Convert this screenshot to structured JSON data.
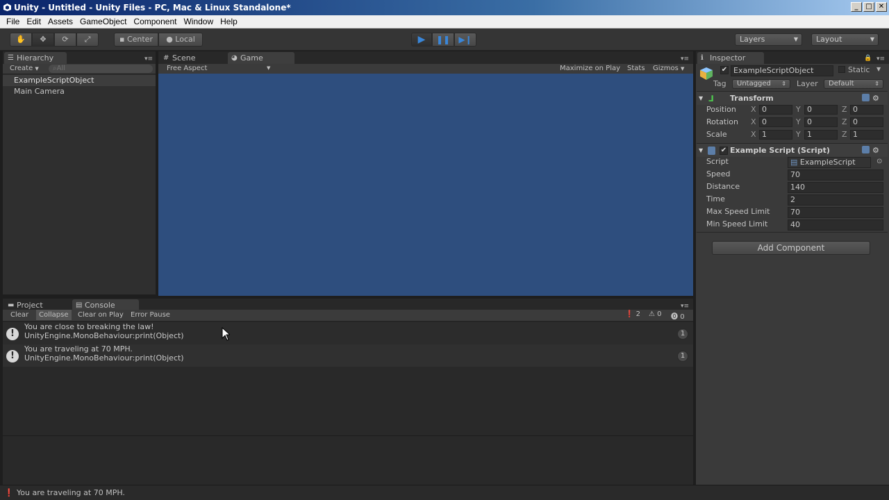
{
  "window": {
    "title": "Unity - Untitled - Unity Files - PC, Mac & Linux Standalone*",
    "minimize": "_",
    "maximize": "□",
    "close": "✕"
  },
  "menu": [
    "File",
    "Edit",
    "Assets",
    "GameObject",
    "Component",
    "Window",
    "Help"
  ],
  "toolbar": {
    "pivot_label": "Center",
    "space_label": "Local",
    "layers_label": "Layers",
    "layout_label": "Layout"
  },
  "hierarchy": {
    "tab_label": "Hierarchy",
    "create_label": "Create",
    "search_placeholder": "All",
    "items": [
      "ExampleScriptObject",
      "Main Camera"
    ]
  },
  "scene": {
    "scene_tab": "Scene",
    "game_tab": "Game",
    "aspect": "Free Aspect",
    "maximize": "Maximize on Play",
    "stats": "Stats",
    "gizmos": "Gizmos"
  },
  "inspector": {
    "tab_label": "Inspector",
    "object_name": "ExampleScriptObject",
    "static_label": "Static",
    "tag_label": "Tag",
    "tag_value": "Untagged",
    "layer_label": "Layer",
    "layer_value": "Default",
    "transform": {
      "title": "Transform",
      "rows": [
        {
          "label": "Position",
          "x": "0",
          "y": "0",
          "z": "0"
        },
        {
          "label": "Rotation",
          "x": "0",
          "y": "0",
          "z": "0"
        },
        {
          "label": "Scale",
          "x": "1",
          "y": "1",
          "z": "1"
        }
      ],
      "axis_x": "X",
      "axis_y": "Y",
      "axis_z": "Z"
    },
    "script": {
      "title": "Example Script (Script)",
      "script_label": "Script",
      "script_value": "ExampleScript",
      "fields": [
        {
          "label": "Speed",
          "value": "70"
        },
        {
          "label": "Distance",
          "value": "140"
        },
        {
          "label": "Time",
          "value": "2"
        },
        {
          "label": "Max Speed Limit",
          "value": "70"
        },
        {
          "label": "Min Speed Limit",
          "value": "40"
        }
      ]
    },
    "add_component": "Add Component"
  },
  "console": {
    "project_tab": "Project",
    "console_tab": "Console",
    "buttons": [
      "Clear",
      "Collapse",
      "Clear on Play",
      "Error Pause"
    ],
    "counts": {
      "log": "2",
      "warn": "0",
      "error": "0"
    },
    "entries": [
      {
        "line1": "You are close to breaking the law!",
        "line2": "UnityEngine.MonoBehaviour:print(Object)",
        "count": "1"
      },
      {
        "line1": "You are traveling at 70 MPH.",
        "line2": "UnityEngine.MonoBehaviour:print(Object)",
        "count": "1"
      }
    ]
  },
  "status": {
    "message": "You are traveling at 70 MPH."
  },
  "colors": {
    "game_background": "#2e4e7e",
    "play_button": "#3a86d8"
  }
}
